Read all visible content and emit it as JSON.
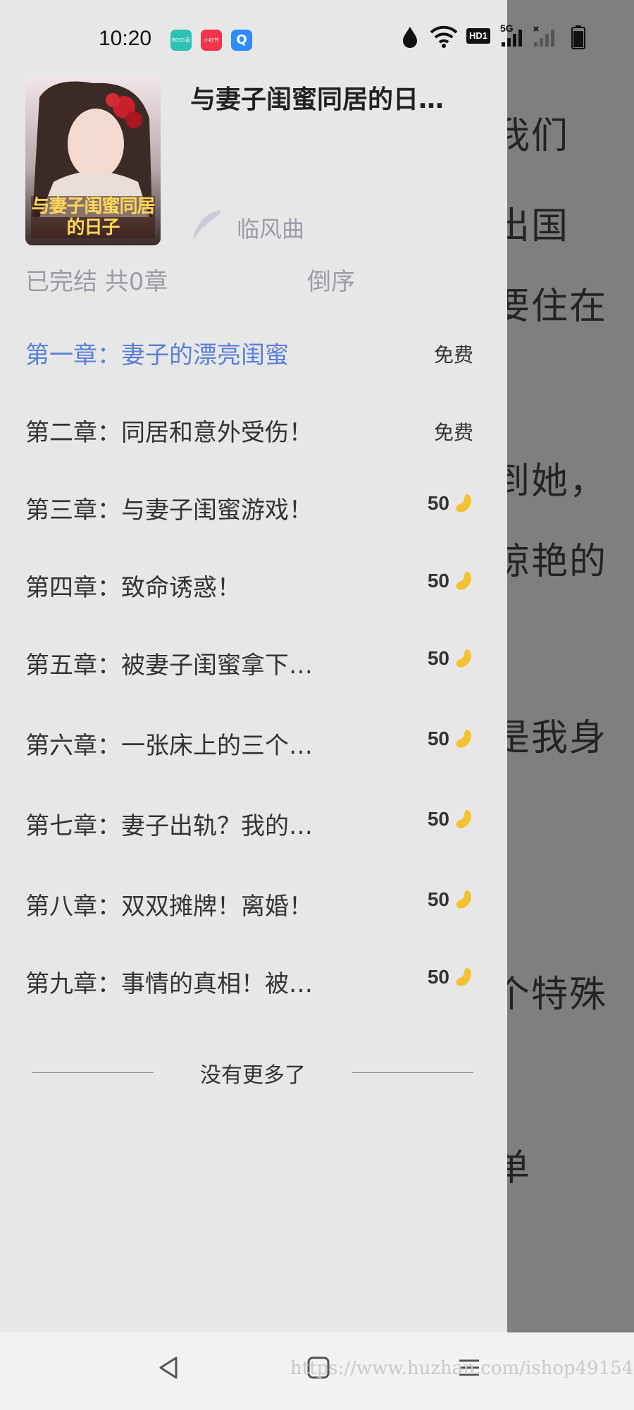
{
  "status_bar": {
    "time": "10:20",
    "apps": [
      {
        "name": "BOSS直聘",
        "icon": "boss-zhipin-icon"
      },
      {
        "name": "小红书",
        "icon": "xiaohongshu-icon"
      },
      {
        "name": "Q",
        "icon": "browser-q-icon"
      }
    ],
    "indicators": [
      "data-saver-icon",
      "wifi-icon",
      "hd-icon",
      "5g-signal-icon",
      "no-signal-icon",
      "battery-icon"
    ],
    "hd_label": "HD1",
    "network_label": "5G"
  },
  "background_text": [
    "我们",
    "出国",
    "要住在",
    "到她，",
    "惊艳的",
    "是我身",
    "个特殊",
    "单"
  ],
  "book": {
    "cover_text": "与妻子闺蜜同居的日子",
    "title": "与妻子闺蜜同居的日…",
    "author": "临风曲"
  },
  "catalog": {
    "summary": "已完结 共0章",
    "sort_label": "倒序",
    "chapters": [
      {
        "title": "第一章：妻子的漂亮闺蜜",
        "price": "免费",
        "active": true
      },
      {
        "title": "第二章：同居和意外受伤！",
        "price": "免费"
      },
      {
        "title": "第三章：与妻子闺蜜游戏！",
        "cost": "50"
      },
      {
        "title": "第四章：致命诱惑！",
        "cost": "50"
      },
      {
        "title": "第五章：被妻子闺蜜拿下…",
        "cost": "50"
      },
      {
        "title": "第六章：一张床上的三个…",
        "cost": "50"
      },
      {
        "title": "第七章：妻子出轨？我的…",
        "cost": "50"
      },
      {
        "title": "第八章：双双摊牌！离婚！",
        "cost": "50"
      },
      {
        "title": "第九章：事情的真相！被…",
        "cost": "50"
      }
    ],
    "end_text": "没有更多了"
  },
  "navbar": {
    "buttons": [
      "back-icon",
      "home-icon",
      "menu-icon"
    ],
    "watermark": "https://www.huzhan.com/ishop49154"
  },
  "colors": {
    "drawer_bg": "#e7e7e7",
    "active_chapter": "#5a7fd8",
    "muted_text": "#9a9ca7",
    "bean": "#f2c230"
  }
}
